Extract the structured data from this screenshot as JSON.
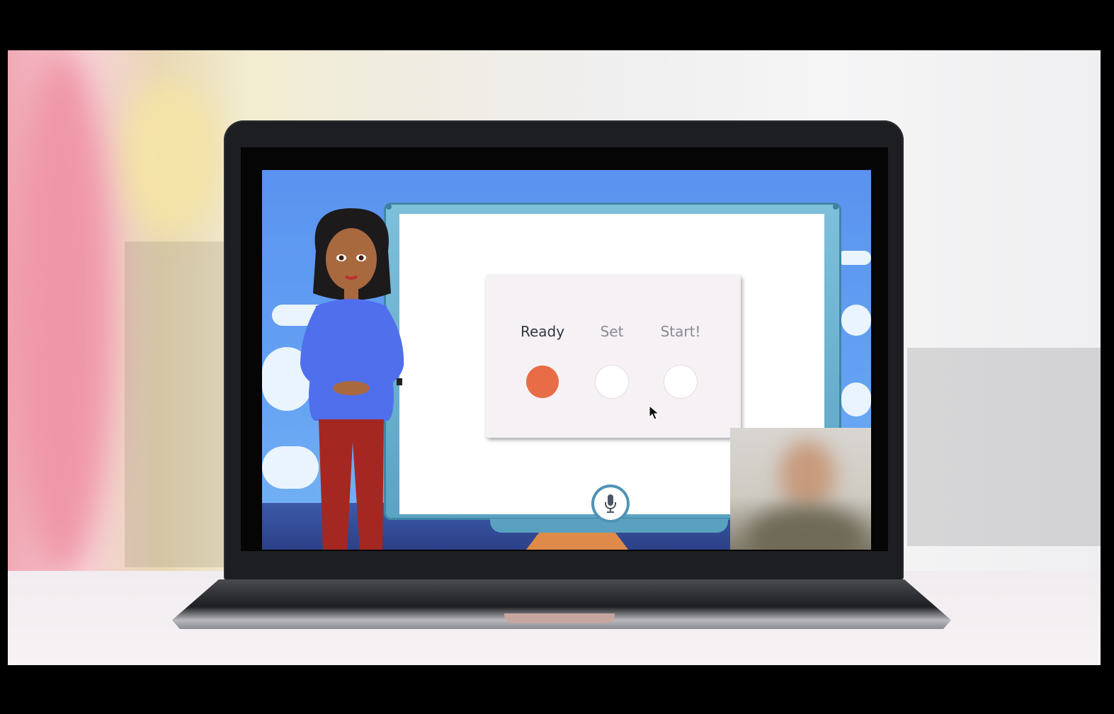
{
  "lesson": {
    "steps": [
      {
        "label": "Ready",
        "active": true
      },
      {
        "label": "Set",
        "active": false
      },
      {
        "label": "Start!",
        "active": false
      }
    ]
  },
  "colors": {
    "active_dot": "#e86c45",
    "inactive_dot": "#ffffff",
    "sky": "#5a93f0"
  },
  "icons": {
    "microphone": "microphone-icon",
    "cursor": "mouse-pointer-icon"
  }
}
